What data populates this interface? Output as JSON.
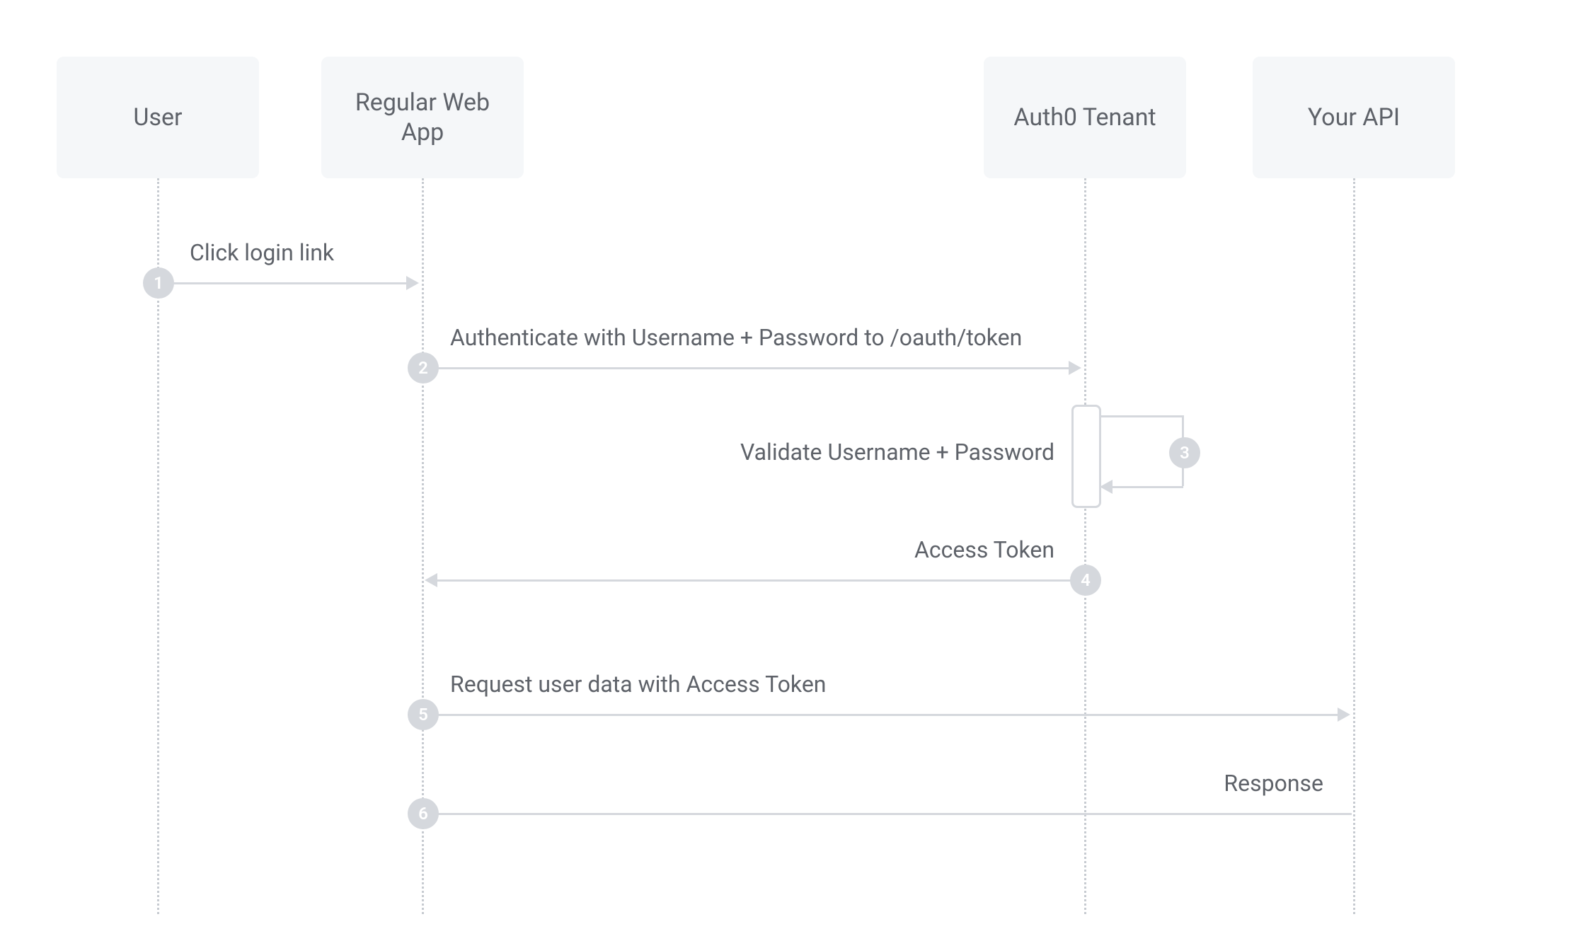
{
  "actors": {
    "user": "User",
    "webapp_line1": "Regular Web",
    "webapp_line2": "App",
    "tenant": "Auth0 Tenant",
    "api": "Your API"
  },
  "steps": {
    "s1": {
      "num": "1",
      "label": "Click login link"
    },
    "s2": {
      "num": "2",
      "label": "Authenticate with Username + Password to /oauth/token"
    },
    "s3": {
      "num": "3",
      "label": "Validate Username + Password"
    },
    "s4": {
      "num": "4",
      "label": "Access Token"
    },
    "s5": {
      "num": "5",
      "label": "Request user data with Access Token"
    },
    "s6": {
      "num": "6",
      "label": "Response"
    }
  }
}
